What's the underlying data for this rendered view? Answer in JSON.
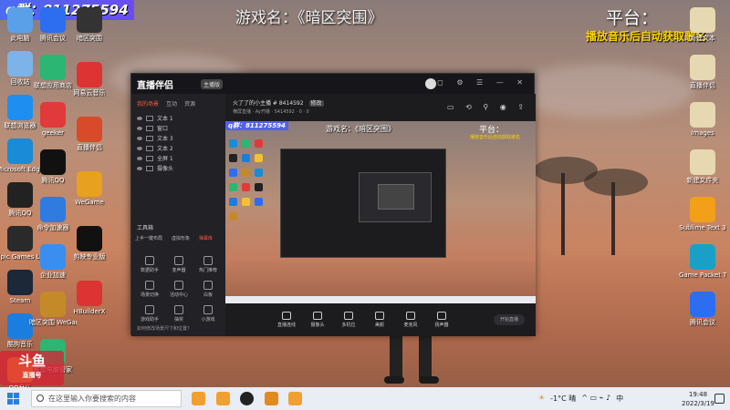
{
  "overlay": {
    "group_badge": "q群：811275594",
    "game_name": "游戏名：《暗区突围》",
    "platform": "平台：",
    "music_note": "播放音乐后自动获取歌名"
  },
  "desktop_left": [
    {
      "label": "此电脑",
      "color": "#5aa0e8",
      "icon": "computer-icon"
    },
    {
      "label": "回收站",
      "color": "#7cb3e8",
      "icon": "recycle-bin-icon"
    },
    {
      "label": "联想浏览器",
      "color": "#1e8ef0",
      "icon": "browser-icon"
    },
    {
      "label": "Microsoft Edge",
      "color": "#1a8bd6",
      "icon": "edge-icon"
    },
    {
      "label": "腾讯QQ",
      "color": "#222",
      "icon": "qq-icon"
    },
    {
      "label": "Epic Games Launcher",
      "color": "#2a2a2a",
      "icon": "epic-icon"
    },
    {
      "label": "Steam",
      "color": "#1b2838",
      "icon": "steam-icon"
    },
    {
      "label": "酷狗音乐",
      "color": "#1a7de0",
      "icon": "kugou-icon"
    },
    {
      "label": "QQ音乐",
      "color": "#f2c230",
      "icon": "qqmusic-icon"
    }
  ],
  "desktop_col2": [
    {
      "label": "腾讯会议",
      "color": "#2d6ef0",
      "icon": "meeting-icon"
    },
    {
      "label": "联想应用商店",
      "color": "#2bb673",
      "icon": "store-icon"
    },
    {
      "label": "geeker",
      "color": "#e03a3a",
      "icon": "geek-icon"
    },
    {
      "label": "腾讯QQ",
      "color": "#111",
      "icon": "qq2-icon"
    },
    {
      "label": "命令加速器",
      "color": "#2f7be0",
      "icon": "accel-icon"
    },
    {
      "label": "企业加速",
      "color": "#3a8ef0",
      "icon": "enterprise-icon"
    },
    {
      "label": "暗区突围 WeGame版",
      "color": "#c48a2a",
      "icon": "game-icon"
    },
    {
      "label": "联想电脑管家",
      "color": "#2bb673",
      "icon": "manager-icon"
    }
  ],
  "desktop_col3": [
    {
      "label": "暗区突围",
      "color": "#333",
      "icon": "shortcut-icon"
    },
    {
      "label": "网易云音乐",
      "color": "#d33",
      "icon": "netease-icon"
    },
    {
      "label": "直播伴侣",
      "color": "#d84a2a",
      "icon": "live-icon"
    },
    {
      "label": "WeGame",
      "color": "#e8a020",
      "icon": "wegame-icon"
    },
    {
      "label": "剪映专业版",
      "color": "#111",
      "icon": "jianying-icon"
    },
    {
      "label": "HBuilderX",
      "color": "#d33",
      "icon": "hbuilder-icon"
    }
  ],
  "desktop_right": [
    {
      "label": "新建文本",
      "color": "#e6d8b0",
      "icon": "file-icon"
    },
    {
      "label": "直播伴侣",
      "color": "#e6d8b0",
      "icon": "file2-icon"
    },
    {
      "label": "Images",
      "color": "#e6d8b0",
      "icon": "images-icon"
    },
    {
      "label": "新建文件夹",
      "color": "#e6d8b0",
      "icon": "folder-icon"
    },
    {
      "label": "Sublime Text 3",
      "color": "#f29f1a",
      "icon": "sublime-icon"
    },
    {
      "label": "Game Packet Tracer",
      "color": "#1aa0c8",
      "icon": "packet-icon"
    },
    {
      "label": "腾讯会议",
      "color": "#2d6ef0",
      "icon": "meeting2-icon"
    }
  ],
  "app": {
    "logo": "直播伴侣",
    "badge": "主播版",
    "tabs": [
      "我的场景",
      "互动",
      "资源"
    ],
    "scenes": [
      "文本 1",
      "窗口",
      "文本 3",
      "文本 2",
      "全屏 1",
      "摄像头"
    ],
    "tools_title": "工具箱",
    "tool_links": [
      "上半一键布局",
      "虚拟形象",
      "弹幕库"
    ],
    "tools": [
      "数据助手",
      "变声器",
      "热门推荐",
      "场景切换",
      "活动中心",
      "白板",
      "游戏助手",
      "抽奖",
      "小游戏"
    ],
    "footer": "如何修改场景尺寸和位置？",
    "room_title": "火了了的小主播 # 8414592",
    "room_tag": "修改",
    "room_meta": "横屏直播 · Ay开播 · 5414592 · 0 · 0",
    "preview_name": "游戏名：《暗区突围》",
    "preview_badge": "q群：811275594",
    "preview_platform": "平台：",
    "preview_music": "播放音乐后自动获取歌名",
    "bottom": [
      "直播连线",
      "摄像头",
      "多机位",
      "美颜",
      "麦克风",
      "扬声器"
    ],
    "start_label": "开始直播"
  },
  "taskbar": {
    "search_placeholder": "在这里输入你要搜索的内容",
    "temperature": "-1°C 晴",
    "ime": "中",
    "time": "19:48",
    "date": "2022/3/19"
  },
  "watermark": {
    "title": "斗鱼",
    "subtitle": "直播号"
  }
}
